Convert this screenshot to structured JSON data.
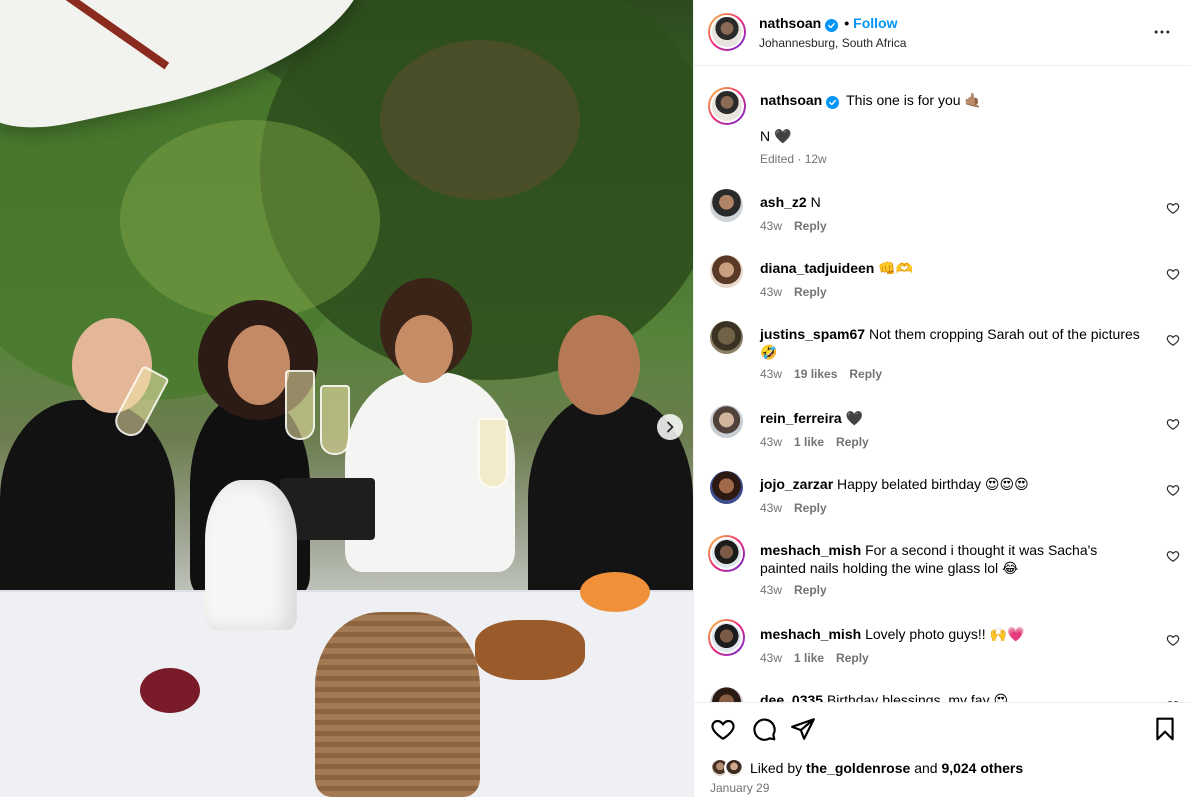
{
  "post": {
    "author": "nathsoan",
    "follow_label": "Follow",
    "location": "Johannesburg, South Africa",
    "caption_line1": "This one is for you 🤙🏽",
    "caption_line2": "N 🖤",
    "caption_meta": "Edited · 12w",
    "liked_by_prefix": "Liked by",
    "liked_by_user": "the_goldenrose",
    "liked_by_and": "and",
    "liked_by_count": "9,024 others",
    "date": "January 29"
  },
  "comments": [
    {
      "user": "ash_z2",
      "text": "N",
      "age": "43w",
      "likes": "",
      "reply": "Reply"
    },
    {
      "user": "diana_tadjuideen",
      "text": "👊🫶",
      "age": "43w",
      "likes": "",
      "reply": "Reply"
    },
    {
      "user": "justins_spam67",
      "text": "Not them cropping Sarah out of the pictures 🤣",
      "age": "43w",
      "likes": "19 likes",
      "reply": "Reply"
    },
    {
      "user": "rein_ferreira",
      "text": "🖤",
      "age": "43w",
      "likes": "1 like",
      "reply": "Reply"
    },
    {
      "user": "jojo_zarzar",
      "text": "Happy belated birthday 😍😍😍",
      "age": "43w",
      "likes": "",
      "reply": "Reply"
    },
    {
      "user": "meshach_mish",
      "text": "For a second i thought it was Sacha's painted nails holding the wine glass lol 😂",
      "age": "43w",
      "likes": "",
      "reply": "Reply"
    },
    {
      "user": "meshach_mish",
      "text": "Lovely photo guys!! 🙌💗",
      "age": "43w",
      "likes": "1 like",
      "reply": "Reply"
    },
    {
      "user": "dee_0335",
      "text": "Birthday blessings, my fav 😍",
      "age": "",
      "likes": "",
      "reply": ""
    }
  ],
  "icons": {
    "like": "heart-icon",
    "comment": "comment-icon",
    "share": "share-icon",
    "save": "bookmark-icon",
    "more": "more-options-icon",
    "next": "chevron-right-icon"
  },
  "colors": {
    "accent": "#0095f6",
    "muted": "#737373",
    "border": "#efefef"
  }
}
